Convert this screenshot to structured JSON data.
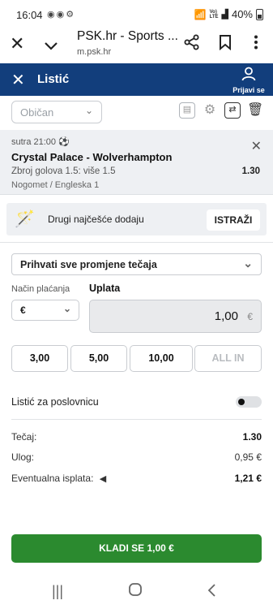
{
  "status_bar": {
    "time": "16:04",
    "battery": "40%",
    "network": "VoLTE"
  },
  "browser": {
    "title": "PSK.hr - Sports ...",
    "url": "m.psk.hr"
  },
  "app_header": {
    "title": "Listić",
    "user_label": "Prijavi se"
  },
  "slip_type": {
    "selected": "Običan"
  },
  "bet": {
    "when": "sutra 21:00",
    "match": "Crystal Palace - Wolverhampton",
    "market": "Zbroj golova 1.5: više 1.5",
    "odds": "1.30",
    "league": "Nogomet / Engleska 1"
  },
  "suggestion": {
    "text": "Drugi najčešće dodaju",
    "button": "ISTRAŽI"
  },
  "odds_change": {
    "selected": "Prihvati sve promjene tečaja"
  },
  "payment": {
    "method_label": "Način plaćanja",
    "currency": "€",
    "stake_label": "Uplata",
    "stake_value": "1,00",
    "stake_currency": "€"
  },
  "quick_stakes": [
    "3,00",
    "5,00",
    "10,00",
    "ALL IN"
  ],
  "shop_slip": {
    "label": "Listić za poslovnicu",
    "enabled": false
  },
  "summary": {
    "odds_label": "Tečaj:",
    "odds_value": "1.30",
    "stake_label": "Ulog:",
    "stake_value": "0,95 €",
    "payout_label": "Eventualna isplata:",
    "payout_value": "1,21 €"
  },
  "cta": {
    "label": "KLADI SE 1,00 €"
  },
  "colors": {
    "header": "#123e7c",
    "cta": "#2b8a2f"
  }
}
